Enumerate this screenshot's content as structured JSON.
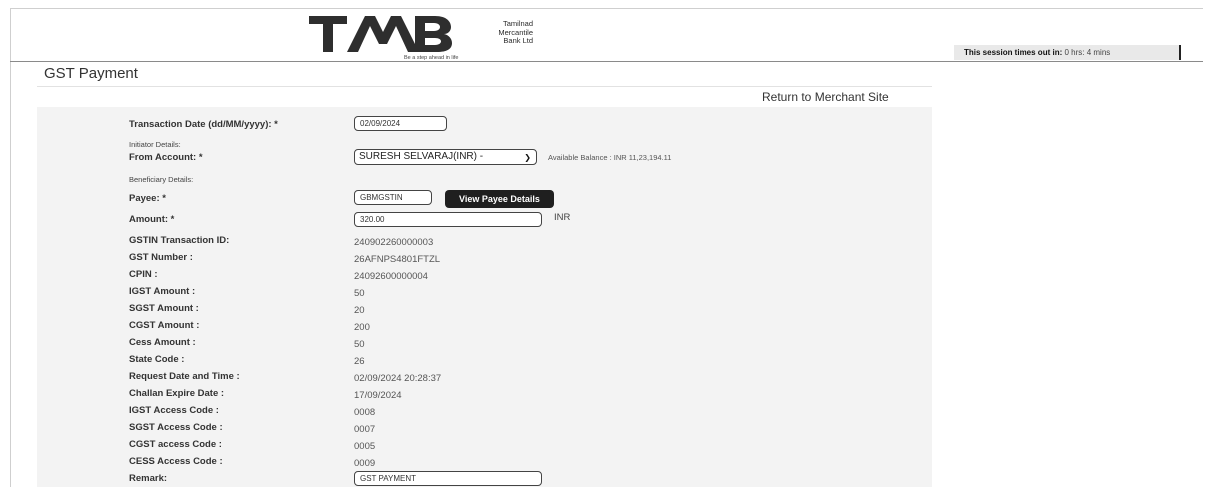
{
  "header": {
    "logo_letters": "TMB",
    "bank_name_lines": [
      "Tamilnad",
      "Mercantile",
      "Bank Ltd"
    ],
    "tagline": "Be a step ahead in life",
    "session_label": "This session times out in:",
    "session_value": "0 hrs: 4 mins"
  },
  "page": {
    "title": "GST Payment",
    "return_link": "Return to Merchant Site"
  },
  "form": {
    "transaction_date_label": "Transaction Date (dd/MM/yyyy): *",
    "transaction_date_value": "02/09/2024",
    "initiator_section": "Initiator Details:",
    "from_account_label": "From Account: *",
    "from_account_value": "SURESH SELVARAJ(INR) -",
    "available_balance": "Available Balance : INR   11,23,194.11",
    "beneficiary_section": "Beneficiary Details:",
    "payee_label": "Payee: *",
    "payee_value": "GBMGSTIN",
    "view_payee_button": "View Payee Details",
    "amount_label": "Amount: *",
    "amount_value": "320.00",
    "amount_currency": "INR",
    "details": [
      {
        "label": "GSTIN Transaction ID:",
        "value": "240902260000003"
      },
      {
        "label": "GST Number :",
        "value": "26AFNPS4801FTZL"
      },
      {
        "label": "CPIN :",
        "value": "24092600000004"
      },
      {
        "label": "IGST Amount :",
        "value": "50"
      },
      {
        "label": "SGST Amount :",
        "value": "20"
      },
      {
        "label": "CGST Amount :",
        "value": "200"
      },
      {
        "label": "Cess Amount :",
        "value": "50"
      },
      {
        "label": "State Code :",
        "value": "26"
      },
      {
        "label": "Request Date and Time :",
        "value": "02/09/2024 20:28:37"
      },
      {
        "label": "Challan Expire Date :",
        "value": "17/09/2024"
      },
      {
        "label": "IGST Access Code :",
        "value": "0008"
      },
      {
        "label": "SGST Access Code :",
        "value": "0007"
      },
      {
        "label": "CGST access Code :",
        "value": "0005"
      },
      {
        "label": "CESS Access Code :",
        "value": "0009"
      }
    ],
    "remark_label": "Remark:",
    "remark_value": "GST PAYMENT"
  }
}
